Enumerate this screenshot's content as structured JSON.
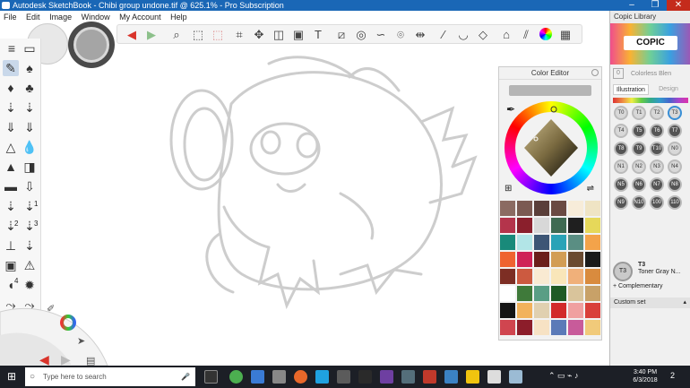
{
  "window": {
    "title": "Autodesk SketchBook - Chibi group undone.tif @ 625.1% - Pro Subscription",
    "min_label": "–",
    "max_label": "❐",
    "close_label": "✕"
  },
  "menu": [
    "File",
    "Edit",
    "Image",
    "Window",
    "My Account",
    "Help"
  ],
  "left_palette": {
    "numbers": [
      "1",
      "2",
      "3",
      "4",
      "1",
      "3"
    ]
  },
  "color_editor": {
    "title": "Color Editor",
    "swatches": [
      "#8b6b62",
      "#7b5a52",
      "#5a3f3a",
      "#6a4a43",
      "#f7ecd9",
      "#efe4c4",
      "#b4344b",
      "#8a1f2c",
      "#d8d8d8",
      "#3f6a52",
      "#1f1f1f",
      "#e6d85a",
      "#198a7a",
      "#b2e5e7",
      "#3d5575",
      "#2aa3b7",
      "#5a8e83",
      "#f3a34a",
      "#ef6330",
      "#cf2357",
      "#6b1f1a",
      "#d29d55",
      "#6a4a30",
      "#1a1a1a",
      "#7d2e24",
      "#cc5a40",
      "#f9ead2",
      "#f9e6b9",
      "#f0b07a",
      "#d98b3e",
      "#ffffff",
      "#3f7a3a",
      "#5a9e85",
      "#1e5a25",
      "#d9c49b",
      "#c8a168",
      "#141414",
      "#f2b25c",
      "#e0d0b0",
      "#d22a2a",
      "#f0a0a0",
      "#d9403a",
      "#d0454f",
      "#8c1d2a",
      "#f7e2c4",
      "#5b7ab8",
      "#c85b9a",
      "#f1ca7a"
    ]
  },
  "copic": {
    "title": "Copic Library",
    "logo": "COPIC",
    "colorless_code": "0",
    "colorless_name": "Colorless Blen",
    "tab_illustration": "Illustration",
    "tab_design": "Design",
    "pens": [
      "T0",
      "T1",
      "T2",
      "T3",
      "T4",
      "T5",
      "T6",
      "T7",
      "T8",
      "T9",
      "T10",
      "N0",
      "N1",
      "N2",
      "N3",
      "N4",
      "N5",
      "N6",
      "N7",
      "N8",
      "N9",
      "N10",
      "100",
      "110"
    ],
    "selected_code": "T3",
    "selected_name": "Toner Gray N...",
    "complementary": "+ Complementary",
    "custom_set": "Custom set"
  },
  "taskbar": {
    "search_placeholder": "Type here to search",
    "time": "3:40 PM",
    "date": "6/3/2018",
    "notification_count": "2"
  }
}
